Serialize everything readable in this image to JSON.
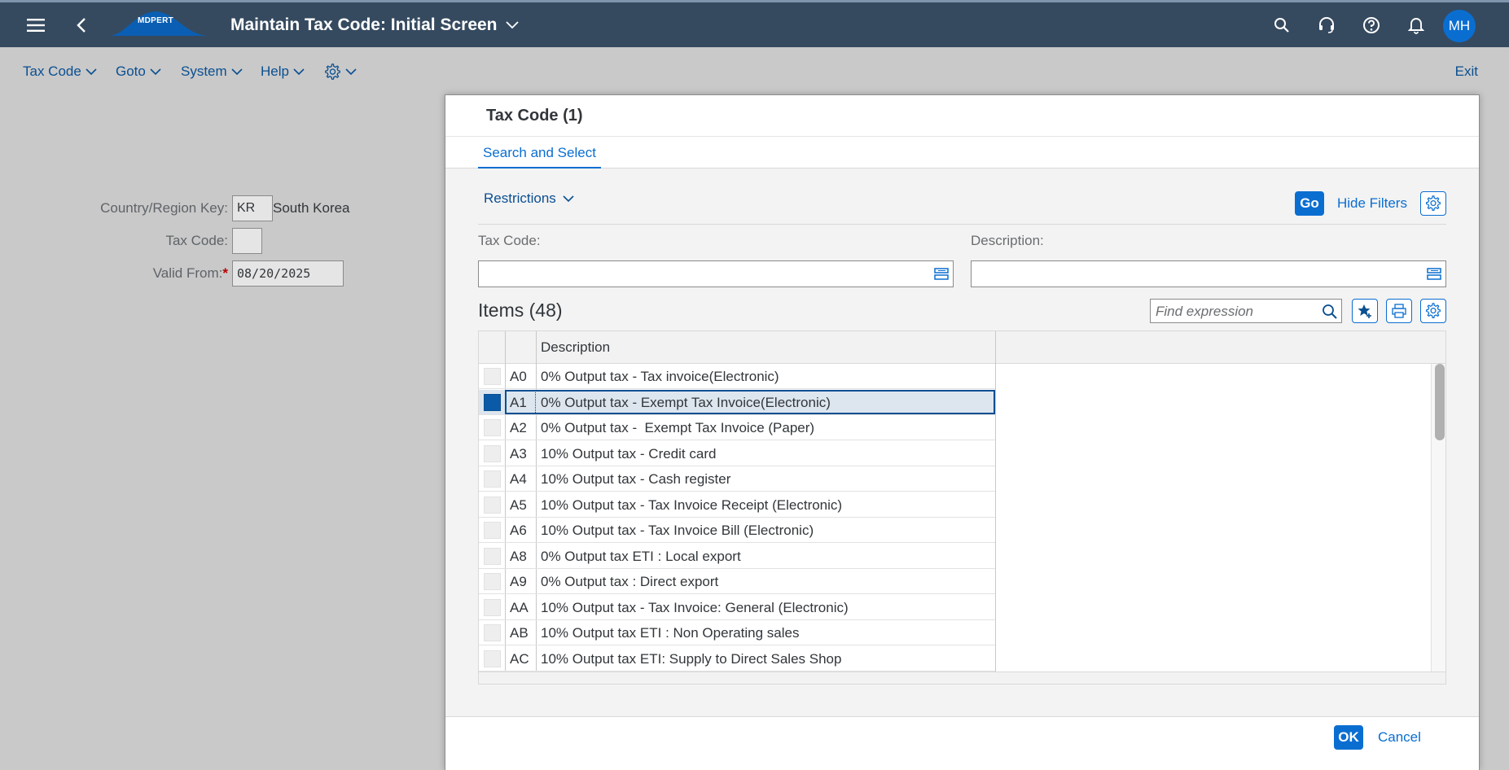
{
  "shell": {
    "logo_text": "MDPERT",
    "title": "Maintain Tax Code: Initial Screen",
    "avatar_initials": "MH",
    "colors": {
      "shell_bg": "#354a5f",
      "accent": "#0a6ed1"
    }
  },
  "menubar": {
    "items": [
      {
        "label": "Tax Code"
      },
      {
        "label": "Goto"
      },
      {
        "label": "System"
      },
      {
        "label": "Help"
      }
    ],
    "settings_icon": "gear-icon",
    "exit_label": "Exit"
  },
  "form": {
    "country_label": "Country/Region Key:",
    "country_value": "KR",
    "country_name": "South Korea",
    "taxcode_label": "Tax Code:",
    "taxcode_value": "",
    "validfrom_label": "Valid From:",
    "validfrom_required": "*",
    "validfrom_value": "08/20/2025"
  },
  "dialog": {
    "title": "Tax Code (1)",
    "tab_label": "Search and Select",
    "restrictions_label": "Restrictions",
    "go_label": "Go",
    "hide_filters_label": "Hide Filters",
    "filter_taxcode_label": "Tax Code:",
    "filter_desc_label": "Description:",
    "items_title": "Items (48)",
    "find_placeholder": "Find expression",
    "column_description": "Description",
    "rows": [
      {
        "code": "A0",
        "desc": "0% Output tax - Tax invoice(Electronic)"
      },
      {
        "code": "A1",
        "desc": "0% Output tax - Exempt Tax Invoice(Electronic)"
      },
      {
        "code": "A2",
        "desc": "0% Output tax -  Exempt Tax Invoice (Paper)"
      },
      {
        "code": "A3",
        "desc": "10% Output tax - Credit card"
      },
      {
        "code": "A4",
        "desc": "10% Output tax - Cash register"
      },
      {
        "code": "A5",
        "desc": "10% Output tax - Tax Invoice Receipt (Electronic)"
      },
      {
        "code": "A6",
        "desc": "10% Output tax - Tax Invoice Bill (Electronic)"
      },
      {
        "code": "A8",
        "desc": "0% Output tax ETI : Local export"
      },
      {
        "code": "A9",
        "desc": "0% Output tax : Direct export"
      },
      {
        "code": "AA",
        "desc": "10% Output tax - Tax Invoice: General (Electronic)"
      },
      {
        "code": "AB",
        "desc": "10% Output tax ETI : Non Operating sales"
      },
      {
        "code": "AC",
        "desc": "10% Output tax ETI: Supply to Direct Sales Shop"
      }
    ],
    "selected_code": "A1",
    "ok_label": "OK",
    "cancel_label": "Cancel"
  }
}
